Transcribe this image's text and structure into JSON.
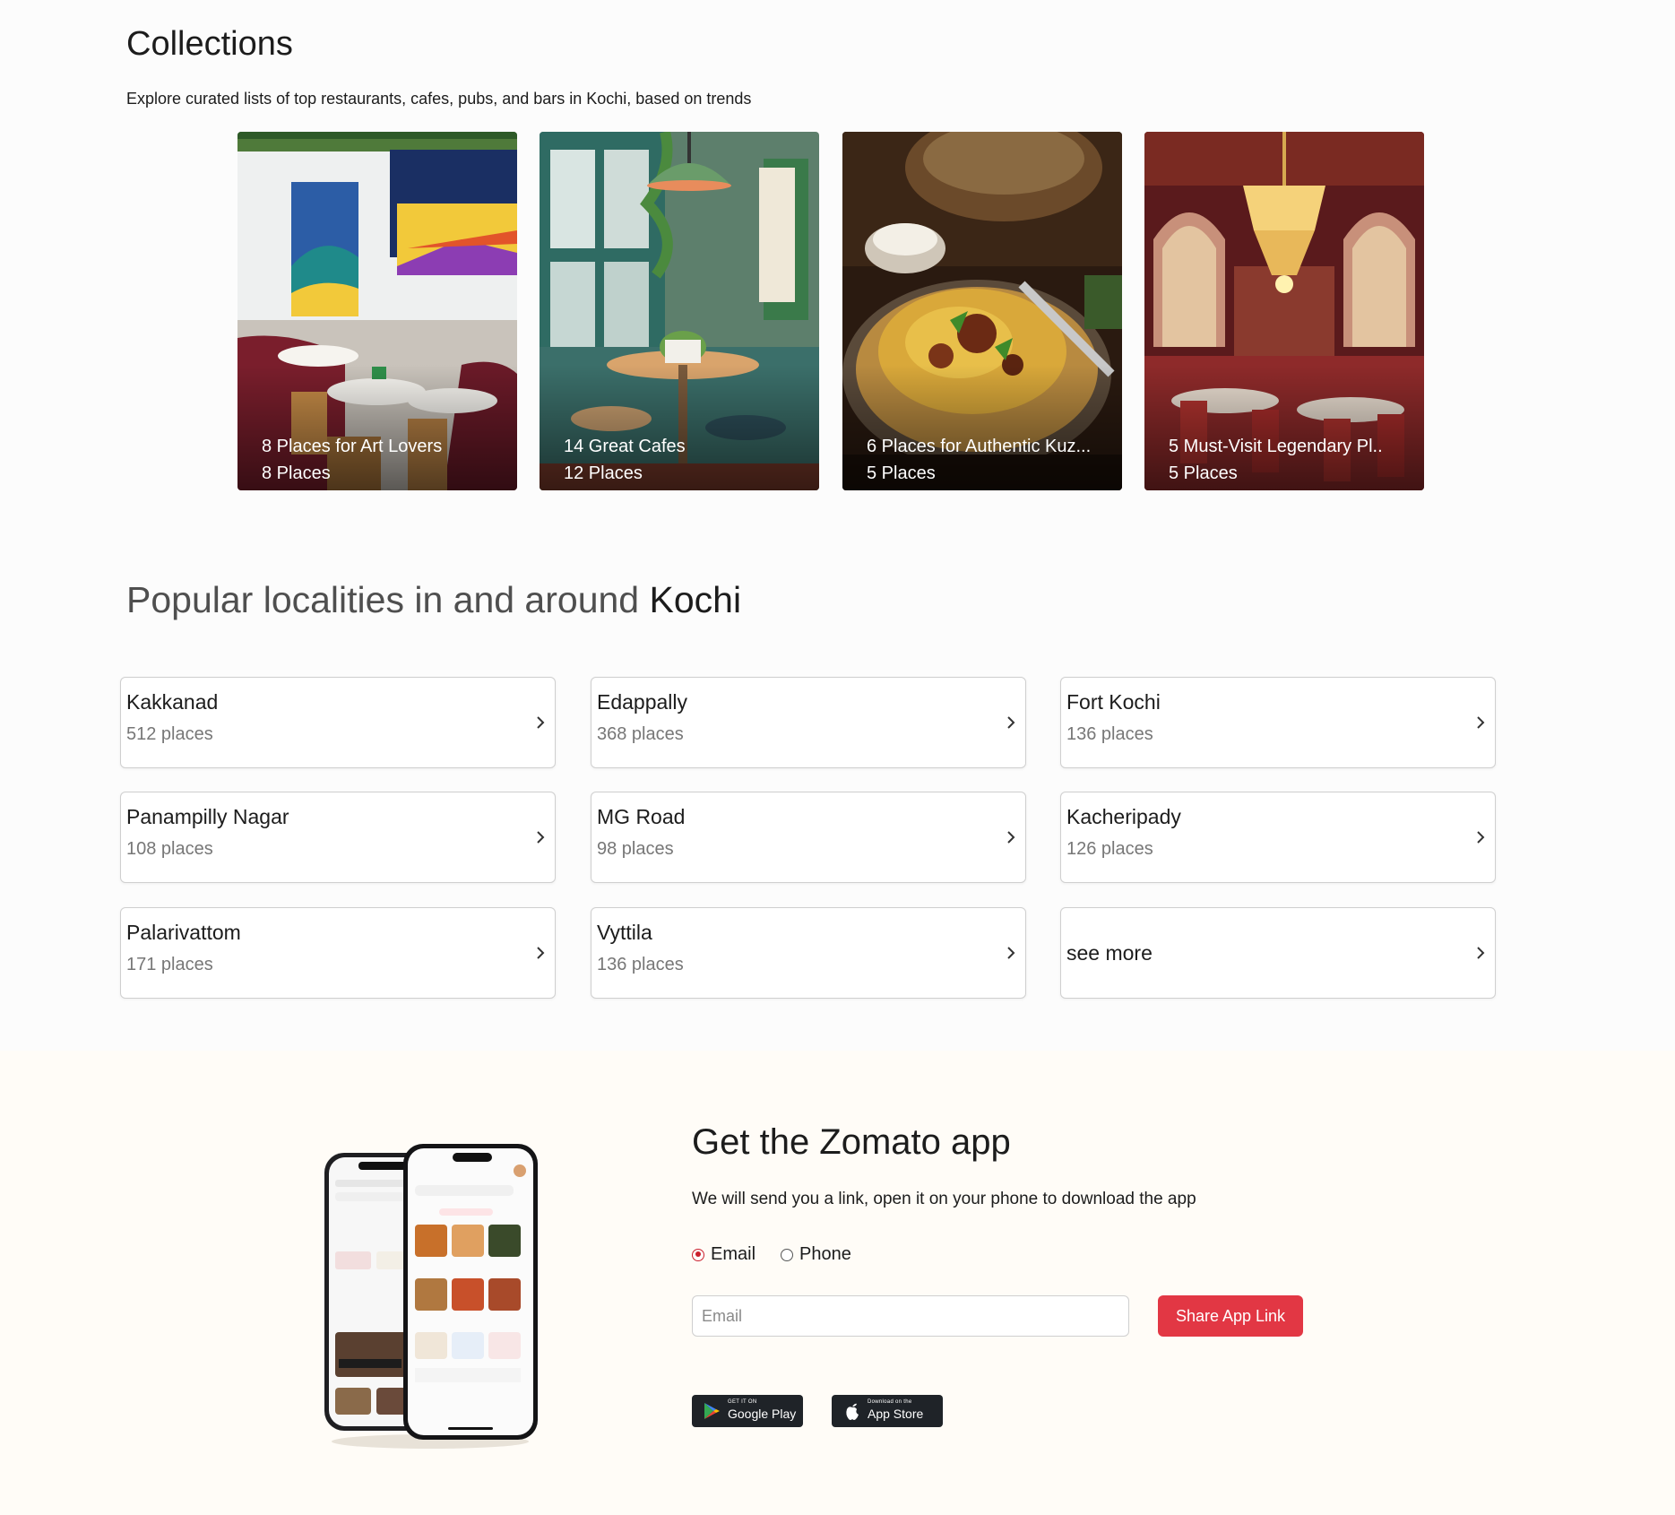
{
  "collections": {
    "title": "Collections",
    "subtitle": "Explore curated lists of top restaurants, cafes, pubs, and bars in Kochi, based on trends",
    "cards": [
      {
        "title": "8 Places for Art Lovers",
        "count": "8 Places"
      },
      {
        "title": "14 Great Cafes",
        "count": "12 Places"
      },
      {
        "title": "6 Places for Authentic Kuz...",
        "count": "5 Places"
      },
      {
        "title": "5 Must-Visit Legendary Pl..",
        "count": "5 Places"
      }
    ]
  },
  "localities": {
    "heading_prefix": "Popular localities in and around ",
    "heading_city": "Kochi",
    "items": [
      {
        "name": "Kakkanad",
        "count": "512 places"
      },
      {
        "name": "Edappally",
        "count": "368 places"
      },
      {
        "name": "Fort Kochi",
        "count": "136 places"
      },
      {
        "name": "Panampilly Nagar",
        "count": "108 places"
      },
      {
        "name": "MG Road",
        "count": "98 places"
      },
      {
        "name": "Kacheripady",
        "count": "126 places"
      },
      {
        "name": "Palarivattom",
        "count": "171 places"
      },
      {
        "name": "Vyttila",
        "count": "136 places"
      }
    ],
    "see_more": "see more"
  },
  "app": {
    "title": "Get the Zomato app",
    "subtitle": "We will send you a link, open it on your phone to download the app",
    "radio_email": "Email",
    "radio_phone": "Phone",
    "email_placeholder": "Email",
    "share_button": "Share App Link",
    "google_play": {
      "small": "GET IT ON",
      "big": "Google Play"
    },
    "app_store": {
      "small": "Download on the",
      "big": "App Store"
    }
  },
  "colors": {
    "accent": "#e23744",
    "radio_active": "#cb202d",
    "app_section_bg": "#fffcf7"
  }
}
